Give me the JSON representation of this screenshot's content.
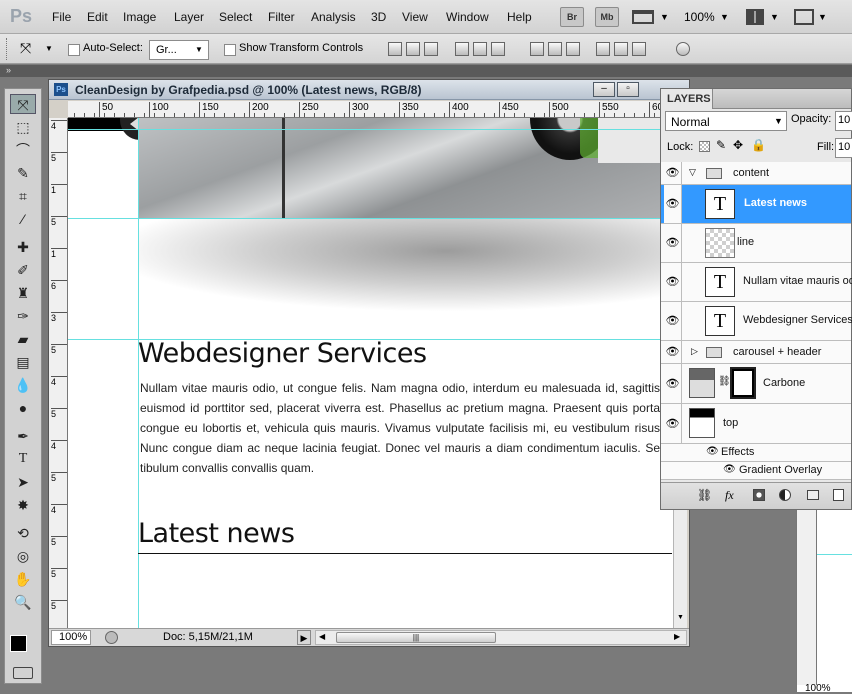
{
  "app": {
    "logo": "Ps"
  },
  "menu": [
    "File",
    "Edit",
    "Image",
    "Layer",
    "Select",
    "Filter",
    "Analysis",
    "3D",
    "View",
    "Window",
    "Help"
  ],
  "menubar_right": {
    "bridge": "Br",
    "minibridge": "Mb",
    "zoom": "100%"
  },
  "options": {
    "auto_select_label": "Auto-Select:",
    "auto_select_value": "Gr...",
    "show_transform_label": "Show Transform Controls"
  },
  "document": {
    "title": "CleanDesign by Grafpedia.psd @ 100% (Latest news, RGB/8)",
    "ruler_ticks": [
      "50",
      "100",
      "150",
      "200",
      "250",
      "300",
      "350",
      "400",
      "450",
      "500",
      "550",
      "60"
    ],
    "vruler_ticks": [
      "4",
      "5",
      "1",
      "5",
      "1",
      "6",
      "3",
      "5",
      "4",
      "5",
      "4",
      "5",
      "4",
      "5",
      "5",
      "5"
    ],
    "heading1": "Webdesigner Services",
    "body": "Nullam vitae mauris odio, ut congue felis. Nam magna odio, interdum eu malesuada id, sagittis euismod id porttitor sed, placerat viverra est. Phasellus ac pretium magna. Praesent quis porta congue eu lobortis et, vehicula quis mauris. Vivamus vulputate facilisis mi, eu vestibulum risus Nunc congue diam ac neque lacinia feugiat. Donec vel mauris a diam condimentum iaculis. Se tibulum convallis convallis quam.",
    "heading2": "Latest news",
    "status_zoom": "100%",
    "status_doc": "Doc: 5,15M/21,1M"
  },
  "layers": {
    "tab": "LAYERS",
    "blend": "Normal",
    "opacity_label": "Opacity:",
    "opacity_value": "10",
    "lock_label": "Lock:",
    "fill_label": "Fill:",
    "fill_value": "10",
    "items": [
      {
        "name": "content",
        "kind": "group-open"
      },
      {
        "name": "Latest news",
        "kind": "text",
        "selected": true
      },
      {
        "name": "line",
        "kind": "pixel"
      },
      {
        "name": "Nullam vitae mauris odi",
        "kind": "text"
      },
      {
        "name": "Webdesigner Services",
        "kind": "text"
      },
      {
        "name": "carousel + header",
        "kind": "group-closed"
      },
      {
        "name": "Carbone",
        "kind": "masked"
      },
      {
        "name": "top",
        "kind": "pixel-black"
      },
      {
        "name": "Effects",
        "kind": "effects"
      },
      {
        "name": "Gradient Overlay",
        "kind": "effect"
      }
    ],
    "footer_fx": "fx"
  },
  "right_zoom": "100%",
  "colors": {
    "accent": "#3399ff",
    "guide": "#66e0e0"
  }
}
